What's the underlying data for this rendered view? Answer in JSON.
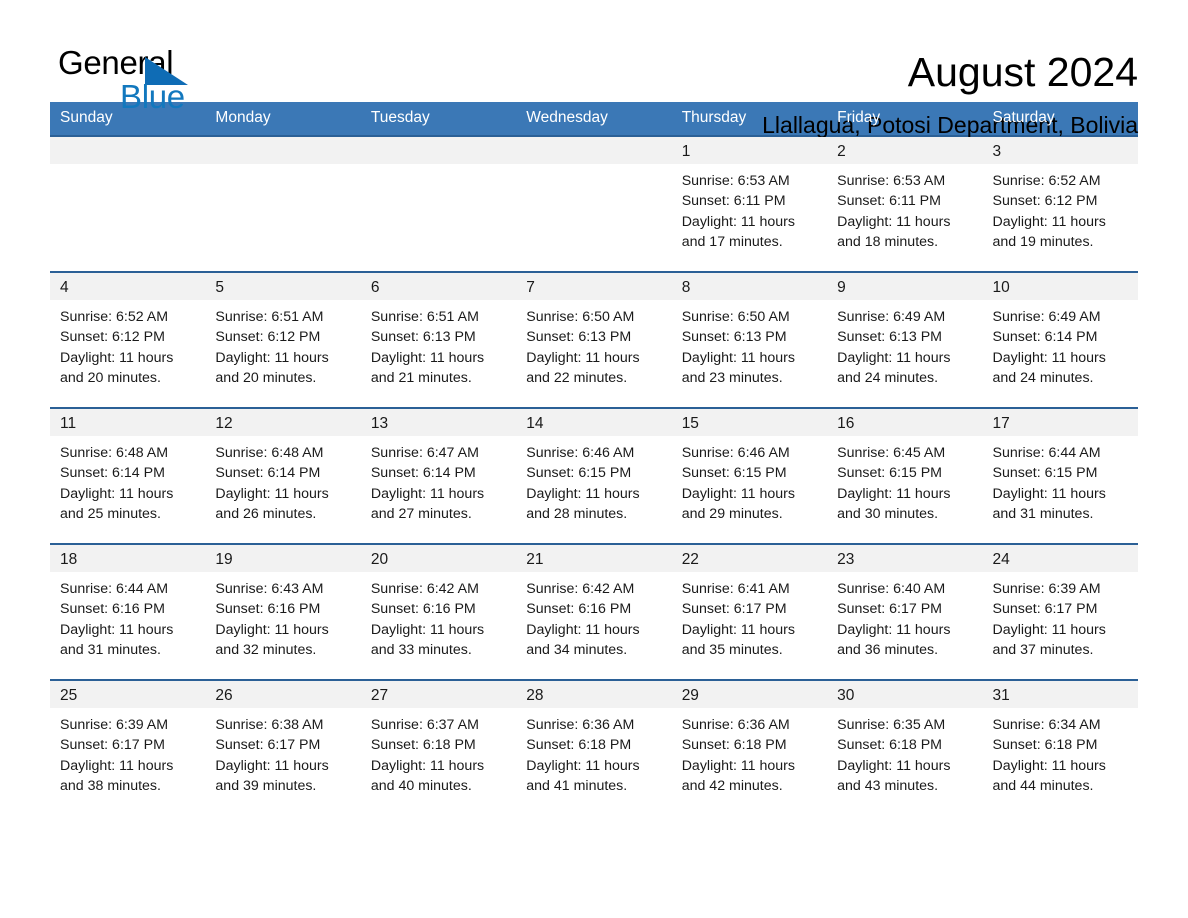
{
  "logo": {
    "word1": "General",
    "word2": "Blue",
    "triangle_color": "#0f6cb5",
    "word2_color": "#1278be"
  },
  "header": {
    "month_title": "August 2024",
    "location": "Llallagua, Potosi Department, Bolivia"
  },
  "calendar": {
    "header_bg": "#3b78b6",
    "header_text_color": "#ffffff",
    "daynum_band_bg": "#f2f2f2",
    "row_border_color": "#2b6096",
    "weekday_headers": [
      "Sunday",
      "Monday",
      "Tuesday",
      "Wednesday",
      "Thursday",
      "Friday",
      "Saturday"
    ],
    "weeks": [
      [
        {
          "day": "",
          "empty": true
        },
        {
          "day": "",
          "empty": true
        },
        {
          "day": "",
          "empty": true
        },
        {
          "day": "",
          "empty": true
        },
        {
          "day": "1",
          "sunrise": "Sunrise: 6:53 AM",
          "sunset": "Sunset: 6:11 PM",
          "daylight_line1": "Daylight: 11 hours",
          "daylight_line2": "and 17 minutes."
        },
        {
          "day": "2",
          "sunrise": "Sunrise: 6:53 AM",
          "sunset": "Sunset: 6:11 PM",
          "daylight_line1": "Daylight: 11 hours",
          "daylight_line2": "and 18 minutes."
        },
        {
          "day": "3",
          "sunrise": "Sunrise: 6:52 AM",
          "sunset": "Sunset: 6:12 PM",
          "daylight_line1": "Daylight: 11 hours",
          "daylight_line2": "and 19 minutes."
        }
      ],
      [
        {
          "day": "4",
          "sunrise": "Sunrise: 6:52 AM",
          "sunset": "Sunset: 6:12 PM",
          "daylight_line1": "Daylight: 11 hours",
          "daylight_line2": "and 20 minutes."
        },
        {
          "day": "5",
          "sunrise": "Sunrise: 6:51 AM",
          "sunset": "Sunset: 6:12 PM",
          "daylight_line1": "Daylight: 11 hours",
          "daylight_line2": "and 20 minutes."
        },
        {
          "day": "6",
          "sunrise": "Sunrise: 6:51 AM",
          "sunset": "Sunset: 6:13 PM",
          "daylight_line1": "Daylight: 11 hours",
          "daylight_line2": "and 21 minutes."
        },
        {
          "day": "7",
          "sunrise": "Sunrise: 6:50 AM",
          "sunset": "Sunset: 6:13 PM",
          "daylight_line1": "Daylight: 11 hours",
          "daylight_line2": "and 22 minutes."
        },
        {
          "day": "8",
          "sunrise": "Sunrise: 6:50 AM",
          "sunset": "Sunset: 6:13 PM",
          "daylight_line1": "Daylight: 11 hours",
          "daylight_line2": "and 23 minutes."
        },
        {
          "day": "9",
          "sunrise": "Sunrise: 6:49 AM",
          "sunset": "Sunset: 6:13 PM",
          "daylight_line1": "Daylight: 11 hours",
          "daylight_line2": "and 24 minutes."
        },
        {
          "day": "10",
          "sunrise": "Sunrise: 6:49 AM",
          "sunset": "Sunset: 6:14 PM",
          "daylight_line1": "Daylight: 11 hours",
          "daylight_line2": "and 24 minutes."
        }
      ],
      [
        {
          "day": "11",
          "sunrise": "Sunrise: 6:48 AM",
          "sunset": "Sunset: 6:14 PM",
          "daylight_line1": "Daylight: 11 hours",
          "daylight_line2": "and 25 minutes."
        },
        {
          "day": "12",
          "sunrise": "Sunrise: 6:48 AM",
          "sunset": "Sunset: 6:14 PM",
          "daylight_line1": "Daylight: 11 hours",
          "daylight_line2": "and 26 minutes."
        },
        {
          "day": "13",
          "sunrise": "Sunrise: 6:47 AM",
          "sunset": "Sunset: 6:14 PM",
          "daylight_line1": "Daylight: 11 hours",
          "daylight_line2": "and 27 minutes."
        },
        {
          "day": "14",
          "sunrise": "Sunrise: 6:46 AM",
          "sunset": "Sunset: 6:15 PM",
          "daylight_line1": "Daylight: 11 hours",
          "daylight_line2": "and 28 minutes."
        },
        {
          "day": "15",
          "sunrise": "Sunrise: 6:46 AM",
          "sunset": "Sunset: 6:15 PM",
          "daylight_line1": "Daylight: 11 hours",
          "daylight_line2": "and 29 minutes."
        },
        {
          "day": "16",
          "sunrise": "Sunrise: 6:45 AM",
          "sunset": "Sunset: 6:15 PM",
          "daylight_line1": "Daylight: 11 hours",
          "daylight_line2": "and 30 minutes."
        },
        {
          "day": "17",
          "sunrise": "Sunrise: 6:44 AM",
          "sunset": "Sunset: 6:15 PM",
          "daylight_line1": "Daylight: 11 hours",
          "daylight_line2": "and 31 minutes."
        }
      ],
      [
        {
          "day": "18",
          "sunrise": "Sunrise: 6:44 AM",
          "sunset": "Sunset: 6:16 PM",
          "daylight_line1": "Daylight: 11 hours",
          "daylight_line2": "and 31 minutes."
        },
        {
          "day": "19",
          "sunrise": "Sunrise: 6:43 AM",
          "sunset": "Sunset: 6:16 PM",
          "daylight_line1": "Daylight: 11 hours",
          "daylight_line2": "and 32 minutes."
        },
        {
          "day": "20",
          "sunrise": "Sunrise: 6:42 AM",
          "sunset": "Sunset: 6:16 PM",
          "daylight_line1": "Daylight: 11 hours",
          "daylight_line2": "and 33 minutes."
        },
        {
          "day": "21",
          "sunrise": "Sunrise: 6:42 AM",
          "sunset": "Sunset: 6:16 PM",
          "daylight_line1": "Daylight: 11 hours",
          "daylight_line2": "and 34 minutes."
        },
        {
          "day": "22",
          "sunrise": "Sunrise: 6:41 AM",
          "sunset": "Sunset: 6:17 PM",
          "daylight_line1": "Daylight: 11 hours",
          "daylight_line2": "and 35 minutes."
        },
        {
          "day": "23",
          "sunrise": "Sunrise: 6:40 AM",
          "sunset": "Sunset: 6:17 PM",
          "daylight_line1": "Daylight: 11 hours",
          "daylight_line2": "and 36 minutes."
        },
        {
          "day": "24",
          "sunrise": "Sunrise: 6:39 AM",
          "sunset": "Sunset: 6:17 PM",
          "daylight_line1": "Daylight: 11 hours",
          "daylight_line2": "and 37 minutes."
        }
      ],
      [
        {
          "day": "25",
          "sunrise": "Sunrise: 6:39 AM",
          "sunset": "Sunset: 6:17 PM",
          "daylight_line1": "Daylight: 11 hours",
          "daylight_line2": "and 38 minutes."
        },
        {
          "day": "26",
          "sunrise": "Sunrise: 6:38 AM",
          "sunset": "Sunset: 6:17 PM",
          "daylight_line1": "Daylight: 11 hours",
          "daylight_line2": "and 39 minutes."
        },
        {
          "day": "27",
          "sunrise": "Sunrise: 6:37 AM",
          "sunset": "Sunset: 6:18 PM",
          "daylight_line1": "Daylight: 11 hours",
          "daylight_line2": "and 40 minutes."
        },
        {
          "day": "28",
          "sunrise": "Sunrise: 6:36 AM",
          "sunset": "Sunset: 6:18 PM",
          "daylight_line1": "Daylight: 11 hours",
          "daylight_line2": "and 41 minutes."
        },
        {
          "day": "29",
          "sunrise": "Sunrise: 6:36 AM",
          "sunset": "Sunset: 6:18 PM",
          "daylight_line1": "Daylight: 11 hours",
          "daylight_line2": "and 42 minutes."
        },
        {
          "day": "30",
          "sunrise": "Sunrise: 6:35 AM",
          "sunset": "Sunset: 6:18 PM",
          "daylight_line1": "Daylight: 11 hours",
          "daylight_line2": "and 43 minutes."
        },
        {
          "day": "31",
          "sunrise": "Sunrise: 6:34 AM",
          "sunset": "Sunset: 6:18 PM",
          "daylight_line1": "Daylight: 11 hours",
          "daylight_line2": "and 44 minutes."
        }
      ]
    ]
  }
}
